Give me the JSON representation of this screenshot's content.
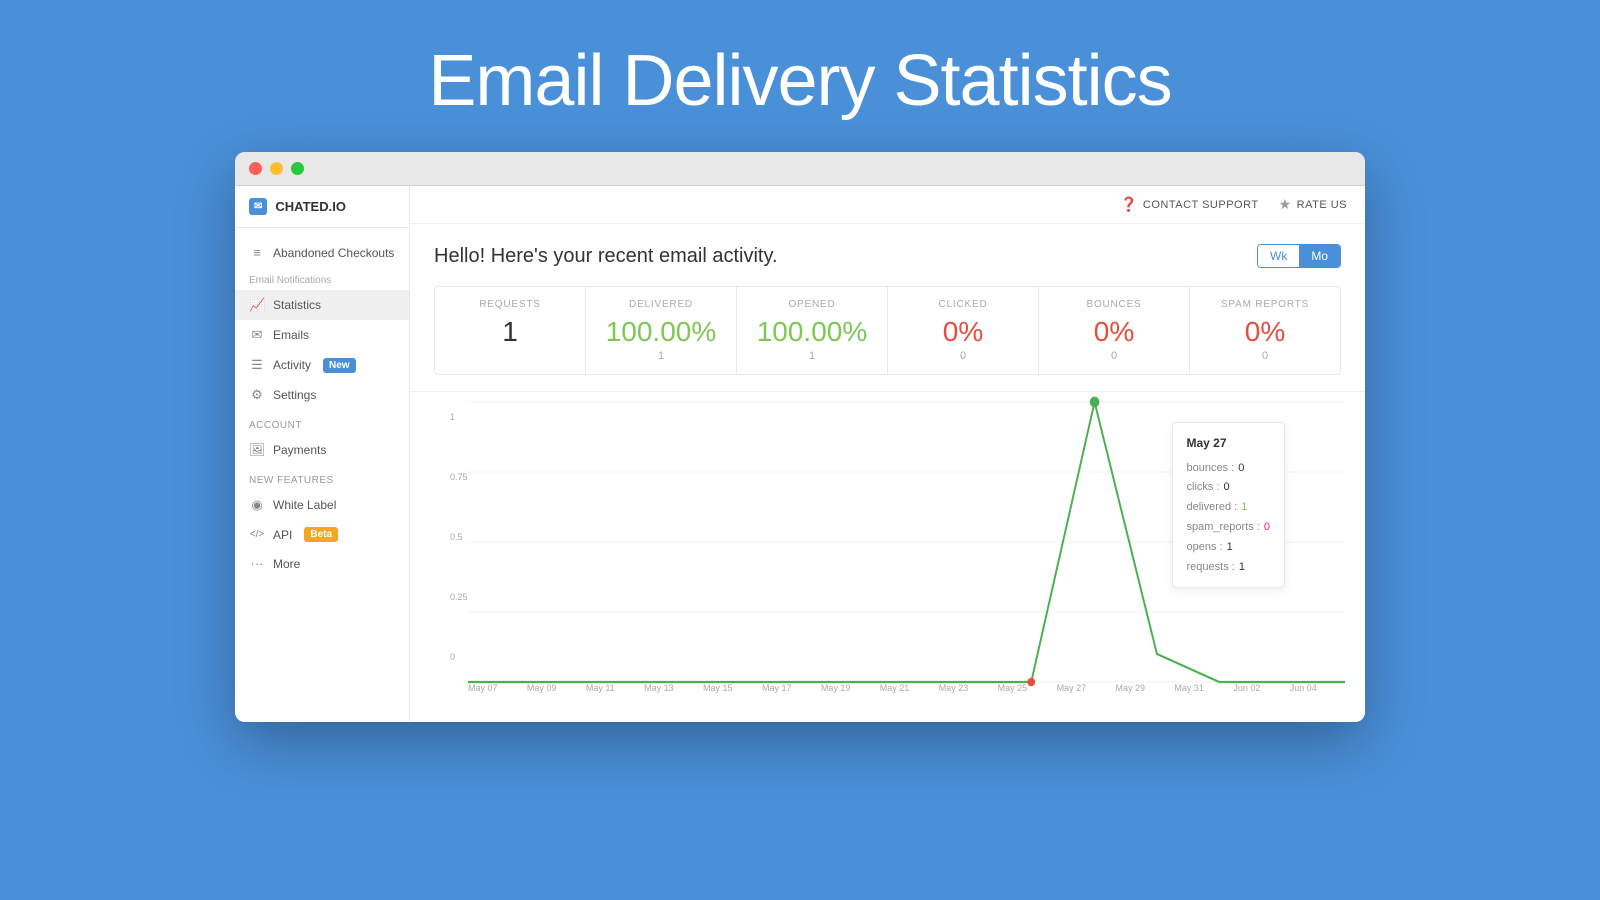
{
  "page": {
    "title": "Email Delivery Statistics"
  },
  "titleBar": {
    "trafficLights": [
      "red",
      "yellow",
      "green"
    ]
  },
  "header": {
    "contactSupport": "CONTACT SUPPORT",
    "rateUs": "RATE US"
  },
  "logo": {
    "icon": "✉",
    "text": "CHATED.IO"
  },
  "sidebar": {
    "topItem": {
      "icon": "≡",
      "label": "Abandoned Checkouts"
    },
    "emailNotificationsLabel": "Email Notifications",
    "items": [
      {
        "icon": "📈",
        "label": "Statistics",
        "active": true
      },
      {
        "icon": "✉",
        "label": "Emails"
      },
      {
        "icon": "≡",
        "label": "Activity",
        "badge": "New",
        "badgeType": "new"
      },
      {
        "icon": "⚙",
        "label": "Settings"
      }
    ],
    "accountLabel": "Account",
    "accountItems": [
      {
        "icon": "🖼",
        "label": "Payments"
      }
    ],
    "newFeaturesLabel": "New Features",
    "newFeaturesItems": [
      {
        "icon": "◉",
        "label": "White Label"
      },
      {
        "icon": "</>",
        "label": "API",
        "badge": "Beta",
        "badgeType": "beta"
      },
      {
        "icon": "···",
        "label": "More"
      }
    ]
  },
  "stats": {
    "heading": "Hello! Here's your recent email activity.",
    "periodButtons": [
      {
        "label": "Wk",
        "active": false
      },
      {
        "label": "Mo",
        "active": true
      }
    ],
    "cards": [
      {
        "label": "REQUESTS",
        "value": "1",
        "sub": "",
        "color": "default"
      },
      {
        "label": "DELIVERED",
        "value": "100.00%",
        "sub": "1",
        "color": "green"
      },
      {
        "label": "OPENED",
        "value": "100.00%",
        "sub": "1",
        "color": "green"
      },
      {
        "label": "CLICKED",
        "value": "0%",
        "sub": "0",
        "color": "red"
      },
      {
        "label": "BOUNCES",
        "value": "0%",
        "sub": "0",
        "color": "red"
      },
      {
        "label": "SPAM REPORTS",
        "value": "0%",
        "sub": "0",
        "color": "red"
      }
    ]
  },
  "chart": {
    "yLabels": [
      "1",
      "0.75",
      "0.5",
      "0.25",
      "0"
    ],
    "xLabels": [
      "May 07",
      "May 09",
      "May 11",
      "May 13",
      "May 15",
      "May 17",
      "May 19",
      "May 21",
      "May 23",
      "May 25",
      "May 27",
      "May 29",
      "May 31",
      "Jun 02",
      "Jun 04"
    ],
    "tooltip": {
      "date": "May 27",
      "rows": [
        {
          "key": "bounces : ",
          "val": "0",
          "color": "default"
        },
        {
          "key": "clicks : ",
          "val": "0",
          "color": "default"
        },
        {
          "key": "delivered : ",
          "val": "1",
          "color": "green"
        },
        {
          "key": "spam_reports : ",
          "val": "0",
          "color": "pink"
        },
        {
          "key": "opens : ",
          "val": "1",
          "color": "default"
        },
        {
          "key": "requests : ",
          "val": "1",
          "color": "default"
        }
      ]
    }
  }
}
